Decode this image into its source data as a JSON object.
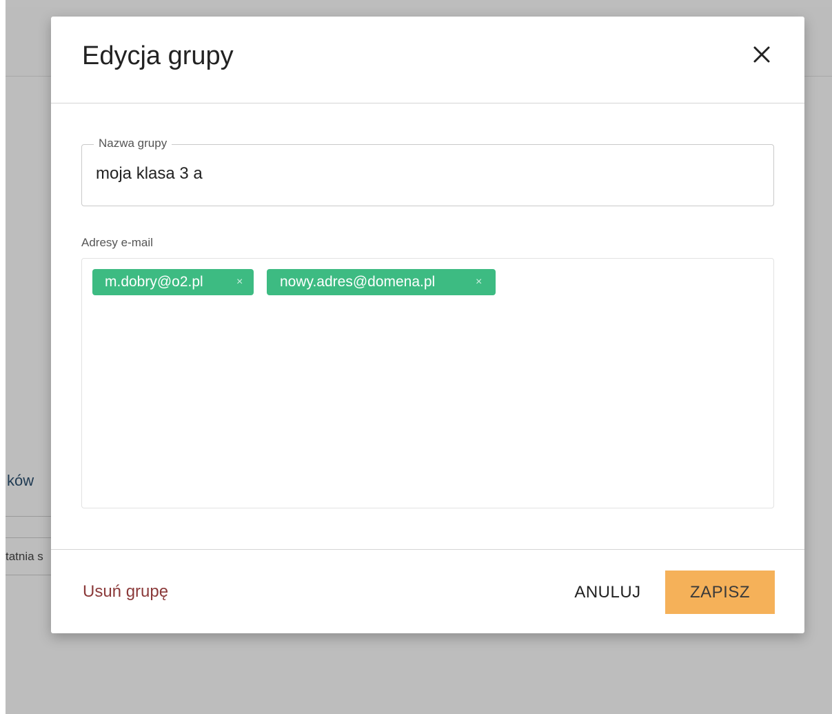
{
  "background": {
    "section_fragment": "ków",
    "column_fragment": "tatnia s"
  },
  "modal": {
    "title": "Edycja grupy",
    "close_icon": "close-icon",
    "group_name": {
      "legend": "Nazwa grupy",
      "value": "moja klasa 3 a"
    },
    "emails": {
      "label": "Adresy e-mail",
      "chips": [
        {
          "address": "m.dobry@o2.pl",
          "remove": "×"
        },
        {
          "address": "nowy.adres@domena.pl",
          "remove": "×"
        }
      ]
    },
    "footer": {
      "delete_label": "Usuń grupę",
      "cancel_label": "ANULUJ",
      "save_label": "ZAPISZ"
    }
  },
  "colors": {
    "overlay": "#bdbdbd",
    "chip": "#3dbb82",
    "save_button": "#f5b159",
    "delete_link": "#8b3a3a"
  }
}
